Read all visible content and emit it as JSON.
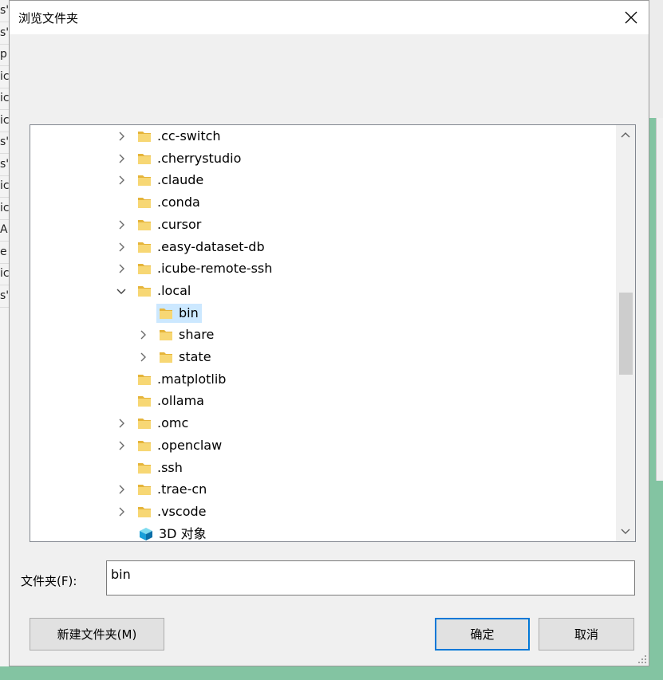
{
  "dialog": {
    "title": "浏览文件夹",
    "folder_label": "文件夹(F):",
    "folder_value": "bin",
    "new_folder_button": "新建文件夹(M)",
    "ok_button": "确定",
    "cancel_button": "取消"
  },
  "tree": {
    "items": [
      {
        "label": ".cc-switch",
        "level": 1,
        "expander": "collapsed",
        "icon": "folder-icon"
      },
      {
        "label": ".cherrystudio",
        "level": 1,
        "expander": "collapsed",
        "icon": "folder-icon"
      },
      {
        "label": ".claude",
        "level": 1,
        "expander": "collapsed",
        "icon": "folder-icon"
      },
      {
        "label": ".conda",
        "level": 1,
        "expander": "none",
        "icon": "folder-icon"
      },
      {
        "label": ".cursor",
        "level": 1,
        "expander": "collapsed",
        "icon": "folder-icon"
      },
      {
        "label": ".easy-dataset-db",
        "level": 1,
        "expander": "collapsed",
        "icon": "folder-icon"
      },
      {
        "label": ".icube-remote-ssh",
        "level": 1,
        "expander": "collapsed",
        "icon": "folder-icon"
      },
      {
        "label": ".local",
        "level": 1,
        "expander": "expanded",
        "icon": "folder-icon"
      },
      {
        "label": "bin",
        "level": 2,
        "expander": "none",
        "icon": "folder-icon",
        "selected": true
      },
      {
        "label": "share",
        "level": 2,
        "expander": "collapsed",
        "icon": "folder-icon"
      },
      {
        "label": "state",
        "level": 2,
        "expander": "collapsed",
        "icon": "folder-icon"
      },
      {
        "label": ".matplotlib",
        "level": 1,
        "expander": "none",
        "icon": "folder-icon"
      },
      {
        "label": ".ollama",
        "level": 1,
        "expander": "none",
        "icon": "folder-icon"
      },
      {
        "label": ".omc",
        "level": 1,
        "expander": "collapsed",
        "icon": "folder-icon"
      },
      {
        "label": ".openclaw",
        "level": 1,
        "expander": "collapsed",
        "icon": "folder-icon"
      },
      {
        "label": ".ssh",
        "level": 1,
        "expander": "none",
        "icon": "folder-icon"
      },
      {
        "label": ".trae-cn",
        "level": 1,
        "expander": "collapsed",
        "icon": "folder-icon"
      },
      {
        "label": ".vscode",
        "level": 1,
        "expander": "collapsed",
        "icon": "folder-icon"
      },
      {
        "label": "3D 对象",
        "level": 0,
        "expander": "none",
        "icon": "3d-objects-icon"
      }
    ]
  },
  "scrollbar": {
    "position_fraction": 0.5
  },
  "background_window": {
    "row_fragments": [
      "s'",
      "s'",
      "p",
      "ic",
      "ic",
      "ic",
      "s'",
      "s'",
      "ic",
      "ic",
      "A",
      "e",
      "ic",
      "s'"
    ]
  },
  "colors": {
    "folder": "#f7d774",
    "folder_dark": "#e5b43a",
    "selection": "#cce8ff",
    "accent": "#0078d7",
    "background_green": "#83c4a2"
  }
}
